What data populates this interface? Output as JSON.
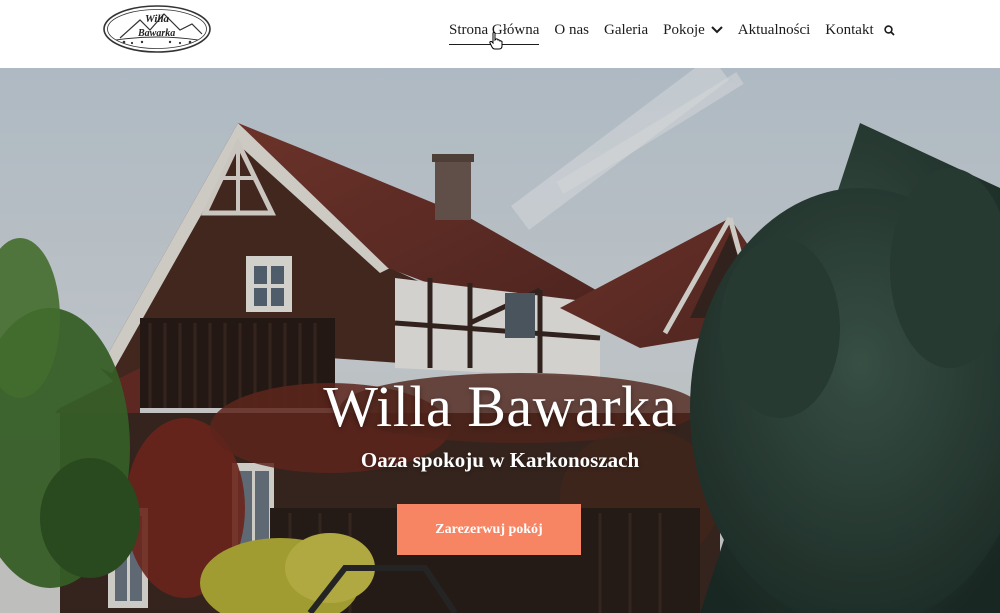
{
  "header": {
    "logo_alt_lines": [
      "Willa",
      "Bawarka"
    ]
  },
  "nav": {
    "items": [
      {
        "label": "Strona Główna",
        "active": true
      },
      {
        "label": "O nas"
      },
      {
        "label": "Galeria"
      },
      {
        "label": "Pokoje",
        "has_dropdown": true
      },
      {
        "label": "Aktualności"
      },
      {
        "label": "Kontakt"
      }
    ],
    "search_icon": "search-icon"
  },
  "hero": {
    "title": "Willa Bawarka",
    "subtitle": "Oaza spokoju w Karkonoszach",
    "cta_label": "Zarezerwuj pokój"
  },
  "colors": {
    "cta": "#f78463",
    "nav_text": "#1c1c1c",
    "hero_text": "#ffffff"
  }
}
